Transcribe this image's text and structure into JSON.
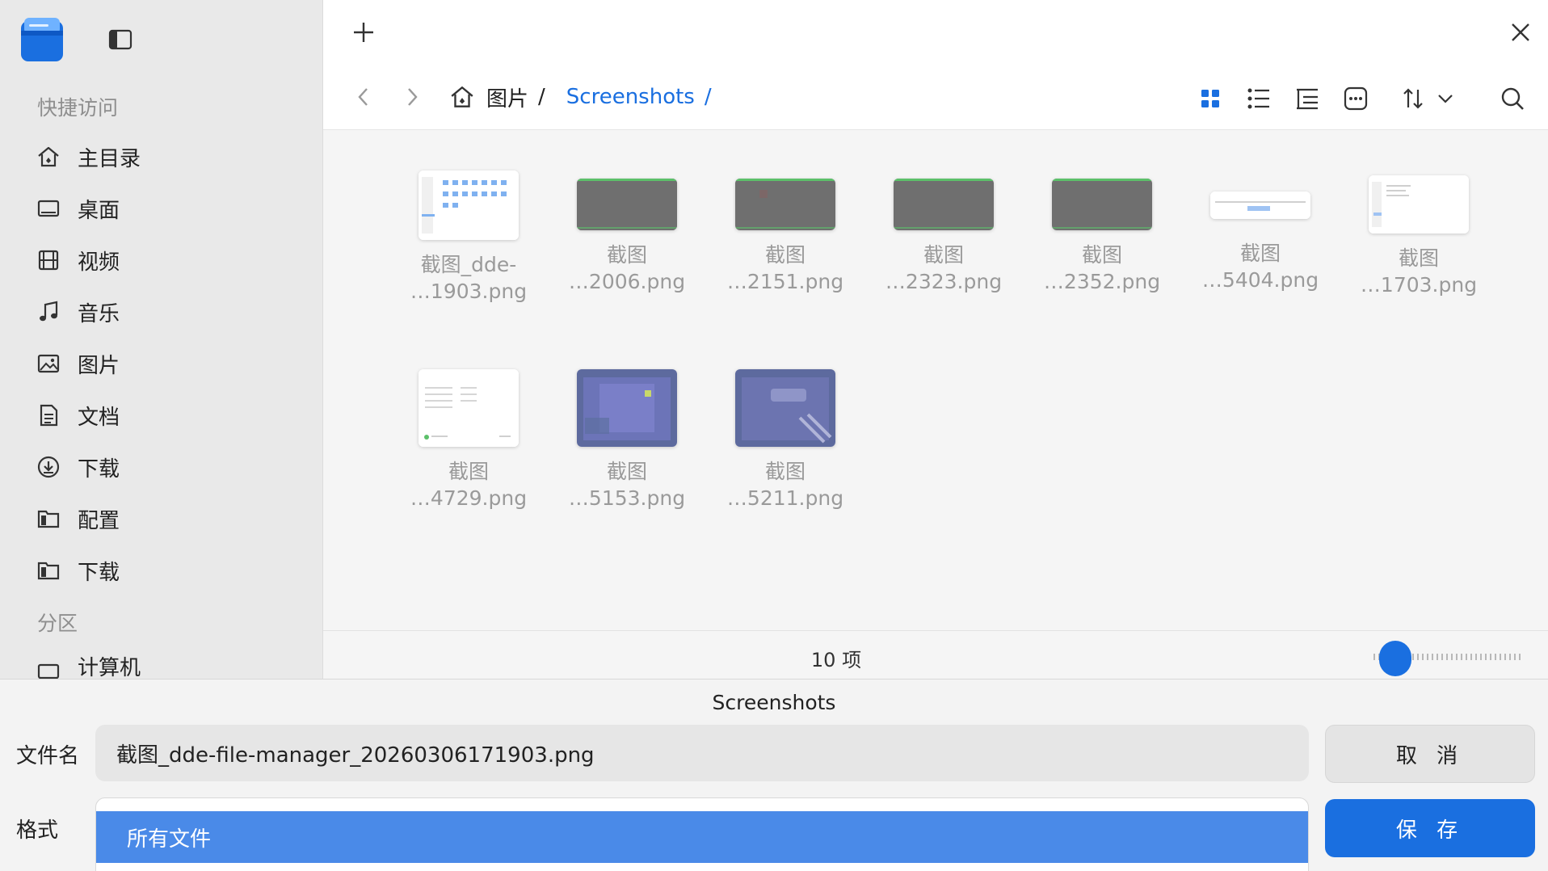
{
  "sidebar": {
    "quick_access_title": "快捷访问",
    "partition_title": "分区",
    "items": [
      {
        "label": "主目录",
        "icon": "home-icon"
      },
      {
        "label": "桌面",
        "icon": "desktop-icon"
      },
      {
        "label": "视频",
        "icon": "video-icon"
      },
      {
        "label": "音乐",
        "icon": "music-icon"
      },
      {
        "label": "图片",
        "icon": "picture-icon"
      },
      {
        "label": "文档",
        "icon": "document-icon"
      },
      {
        "label": "下载",
        "icon": "download-icon"
      },
      {
        "label": "配置",
        "icon": "folder-icon"
      },
      {
        "label": "下载",
        "icon": "folder-icon"
      }
    ],
    "computer_label": "计算机"
  },
  "breadcrumb": {
    "parent": "图片",
    "parent_sep": "/",
    "current": "Screenshots",
    "current_sep": "/"
  },
  "files": [
    {
      "line1": "截图_dde-",
      "line2": "…1903.png"
    },
    {
      "line1": "截图",
      "line2": "…2006.png"
    },
    {
      "line1": "截图",
      "line2": "…2151.png"
    },
    {
      "line1": "截图",
      "line2": "…2323.png"
    },
    {
      "line1": "截图",
      "line2": "…2352.png"
    },
    {
      "line1": "截图",
      "line2": "…5404.png"
    },
    {
      "line1": "截图",
      "line2": "…1703.png"
    },
    {
      "line1": "截图",
      "line2": "…4729.png"
    },
    {
      "line1": "截图",
      "line2": "…5153.png"
    },
    {
      "line1": "截图",
      "line2": "…5211.png"
    }
  ],
  "status": {
    "item_count": "10 项",
    "zoom_level": 0.05
  },
  "dialog": {
    "directory": "Screenshots",
    "filename_label": "文件名",
    "filename_value": "截图_dde-file-manager_20260306171903.png",
    "format_label": "格式",
    "format_selected": "所有文件",
    "cancel_label": "取 消",
    "save_label": "保 存"
  },
  "colors": {
    "accent": "#1a6fe0",
    "selected_option": "#4a8ae8"
  }
}
